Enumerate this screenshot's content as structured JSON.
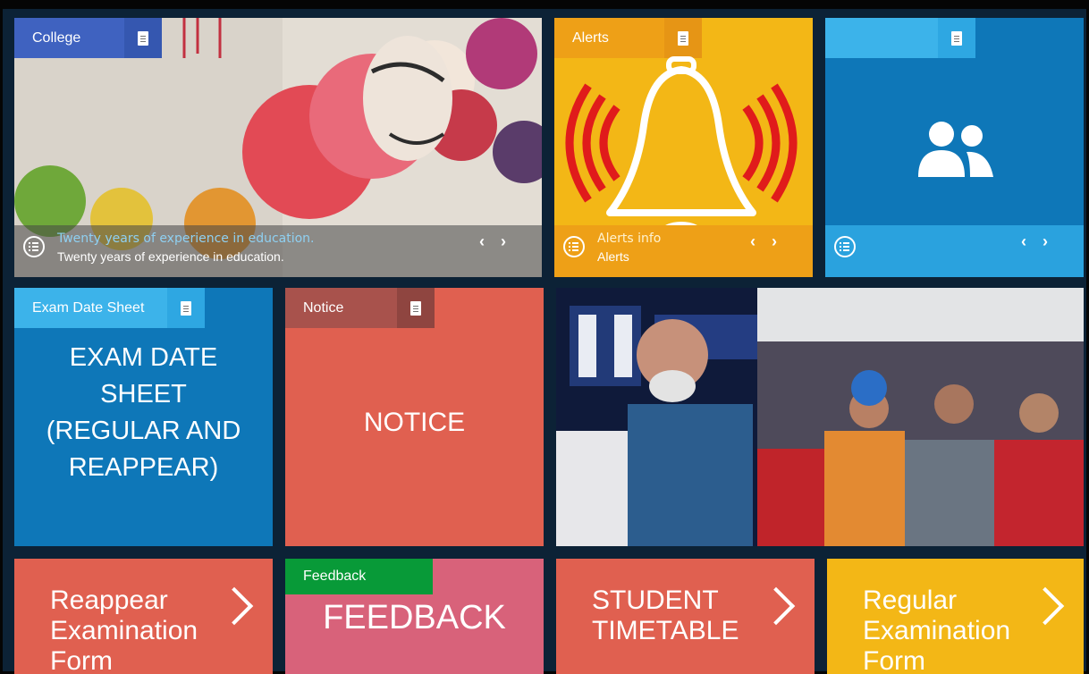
{
  "college": {
    "tag": "College",
    "caption_line1": "Twenty years of experience in education.",
    "caption_line2": "Twenty years of experience in education.",
    "prev": "‹",
    "next": "›"
  },
  "alerts": {
    "tag": "Alerts",
    "caption_line1": "Alerts  info",
    "caption_line2": "Alerts",
    "prev": "‹",
    "next": "›"
  },
  "people": {
    "prev": "‹",
    "next": "›"
  },
  "exam": {
    "tag": "Exam Date Sheet",
    "title": [
      "EXAM DATE",
      "SHEET",
      "(REGULAR AND",
      "REAPPEAR)"
    ]
  },
  "notice": {
    "tag": "Notice",
    "title": "NOTICE"
  },
  "bottom": {
    "reappear": [
      "Reappear",
      "Examination",
      "Form"
    ],
    "feedback_tag": "Feedback",
    "feedback_title": "FEEDBACK",
    "timetable": [
      "STUDENT",
      "TIMETABLE"
    ],
    "regular": [
      "Regular",
      "Examination",
      "Form"
    ]
  },
  "colors": {
    "blue": "#0e77b8",
    "tag_blue": "#3f62c0",
    "tag_light_blue": "#3cb3ea",
    "yellow": "#f3b716",
    "red": "#e06050",
    "pink": "#d8627a",
    "green": "#089a38"
  }
}
